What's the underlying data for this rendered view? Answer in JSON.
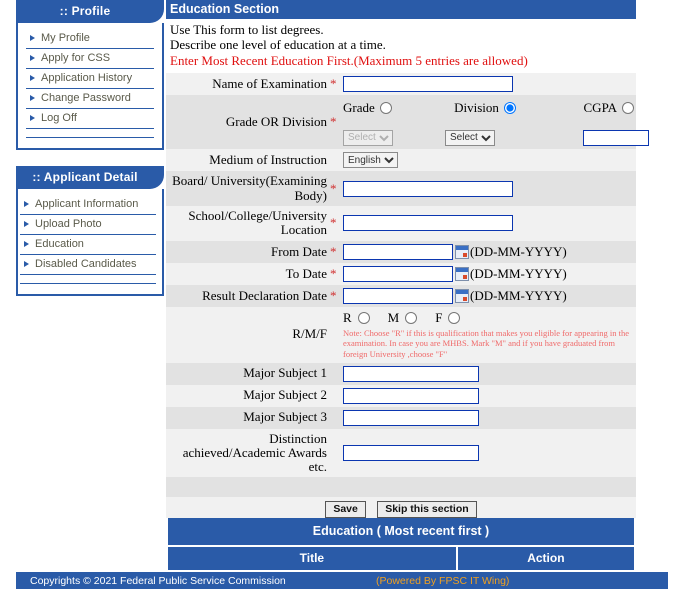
{
  "theme": {
    "brand_blue": "#2a5ba8",
    "warn_red": "#e01010",
    "note_red": "#f06a6a",
    "footer_gold": "#f0a020",
    "input_border": "#0b36b0"
  },
  "sidebar": {
    "profile": {
      "title": ":: Profile",
      "items": [
        {
          "label": "My Profile"
        },
        {
          "label": "Apply for CSS"
        },
        {
          "label": "Application History"
        },
        {
          "label": "Change Password"
        },
        {
          "label": "Log Off"
        }
      ]
    },
    "applicant": {
      "title": ":: Applicant Detail",
      "items": [
        {
          "label": "Applicant Information"
        },
        {
          "label": "Upload Photo"
        },
        {
          "label": "Education"
        },
        {
          "label": "Disabled Candidates"
        }
      ]
    }
  },
  "main": {
    "section_title": "Education Section",
    "instructions": {
      "line1": "Use This form to list degrees.",
      "line2": "Describe one level of education at a time.",
      "line3": "Enter Most Recent Education First.(Maximum 5 entries are allowed)"
    },
    "rows": {
      "exam": {
        "label": "Name of Examination",
        "required": "*",
        "value": ""
      },
      "grade_division": {
        "label": "Grade OR Division",
        "required": "*",
        "options": [
          {
            "label": "Grade",
            "checked": false
          },
          {
            "label": "Division",
            "checked": true
          },
          {
            "label": "CGPA",
            "checked": false
          }
        ],
        "grade_select": {
          "value": "Select",
          "disabled": true
        },
        "division_select": {
          "value": "Select",
          "disabled": false
        },
        "cgpa_input": {
          "value": ""
        }
      },
      "medium": {
        "label": "Medium of Instruction",
        "value": "English"
      },
      "board": {
        "label": "Board/ University(Examining Body)",
        "required": "*",
        "value": ""
      },
      "location": {
        "label": "School/College/University Location",
        "required": "*",
        "value": ""
      },
      "from_date": {
        "label": "From Date",
        "required": "*",
        "value": "",
        "format": "(DD-MM-YYYY)"
      },
      "to_date": {
        "label": "To Date",
        "required": "*",
        "value": "",
        "format": "(DD-MM-YYYY)"
      },
      "result_date": {
        "label": "Result Declaration Date",
        "required": "*",
        "value": "",
        "format": "(DD-MM-YYYY)"
      },
      "rmf": {
        "label": "R/M/F",
        "options": [
          {
            "label": "R",
            "checked": false
          },
          {
            "label": "M",
            "checked": false
          },
          {
            "label": "F",
            "checked": false
          }
        ],
        "note": "Note: Choose \"R\" if this is qualification that makes you eligible for appearing in the examination. In case you are MHBS. Mark \"M\" and if you have graduated from foreign University ,choose \"F\""
      },
      "major1": {
        "label": "Major Subject 1",
        "value": ""
      },
      "major2": {
        "label": "Major Subject 2",
        "value": ""
      },
      "major3": {
        "label": "Major Subject 3",
        "value": ""
      },
      "distinction": {
        "label": "Distinction achieved/Academic Awards etc.",
        "value": ""
      }
    },
    "buttons": {
      "save": "Save",
      "skip": "Skip this section"
    }
  },
  "result_table": {
    "title": "Education ( Most recent first )",
    "columns": [
      "Title",
      "Action"
    ],
    "rows": []
  },
  "footer": {
    "copyright": "Copyrights © 2021 Federal Public Service Commission",
    "powered": "(Powered By FPSC IT Wing)"
  }
}
